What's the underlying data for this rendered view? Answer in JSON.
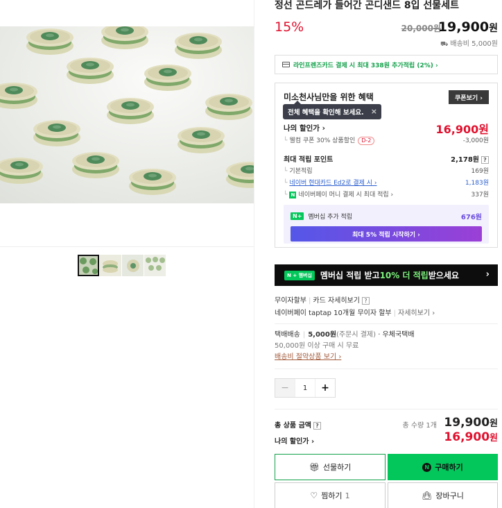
{
  "product": {
    "title": "정선 곤드레가 들어간 곤디샌드 8입 선물세트",
    "discount_rate": "15%",
    "original_price": "20,000원",
    "final_price_num": "19,900",
    "currency": "원",
    "shipping_fee": "배송비 5,000원"
  },
  "card_promo": {
    "text": "라인프렌즈카드 결제 시 최대 338원 추가적립 (2%) ›"
  },
  "benefit": {
    "title": "미소천사님만을 위한 혜택",
    "coupon_button": "쿠폰보기 ›",
    "tooltip": "전체 혜택을 확인해 보세요.",
    "tooltip_close": "×",
    "my_discount_label": "나의 할인가 ›",
    "my_discount_price": "16,900원",
    "coupon_line": "웰컴 쿠폰 30% 상품할인",
    "coupon_badge": "D-2",
    "coupon_value": "-3,000원",
    "max_points_label": "최대 적립 포인트",
    "max_points_value": "2,178원",
    "basic_points_label": "기본적립",
    "basic_points_value": "169원",
    "hyundai_label": "네이버 현대카드 Ed2로 결제 시 ›",
    "hyundai_value": "1,183원",
    "npay_label": "네이버페이 머니 결제 시 최대 적립 ›",
    "npay_value": "337원",
    "membership_label": "멤버십 추가 적립",
    "membership_value": "676원",
    "membership_button": "최대 5% 적립 시작하기 ›"
  },
  "banner": {
    "badge": "N + 멤버십",
    "text_before": "멤버십 적립 받고 ",
    "text_highlight": "10% 더 적립",
    "text_after": " 받으세요",
    "chevron": "›"
  },
  "payment": {
    "installment": "무이자할부",
    "card_detail": "카드 자세히보기",
    "npay_line": "네이버페이 taptap 10개월 무이자 할부",
    "npay_detail": "자세히보기 ›"
  },
  "shipping": {
    "method": "택배배송",
    "fee": "5,000원",
    "fee_note": "(주문시 결제)",
    "carrier": "· 우체국택배",
    "free_condition": "50,000원 이상 구매 시 무료",
    "saver_link": "배송비 절약상품 보기 ›"
  },
  "quantity": {
    "minus": "−",
    "value": "1",
    "plus": "+"
  },
  "totals": {
    "label": "총 상품 금액",
    "count": "총 수량 1개",
    "price_num": "19,900",
    "currency": "원",
    "my_label": "나의 할인가 ›",
    "my_price_num": "16,900",
    "my_currency": "원"
  },
  "buttons": {
    "gift": "선물하기",
    "buy": "구매하기",
    "wish": "찜하기",
    "wish_count": "1",
    "cart": "장바구니"
  },
  "icons": {
    "gift": "gift-icon",
    "buy": "naver-n-icon",
    "wish": "heart-icon",
    "cart": "bag-icon"
  },
  "colors": {
    "accent_red": "#e0112e",
    "naver_green": "#03c75a",
    "membership_purple": "#6a4de0"
  }
}
